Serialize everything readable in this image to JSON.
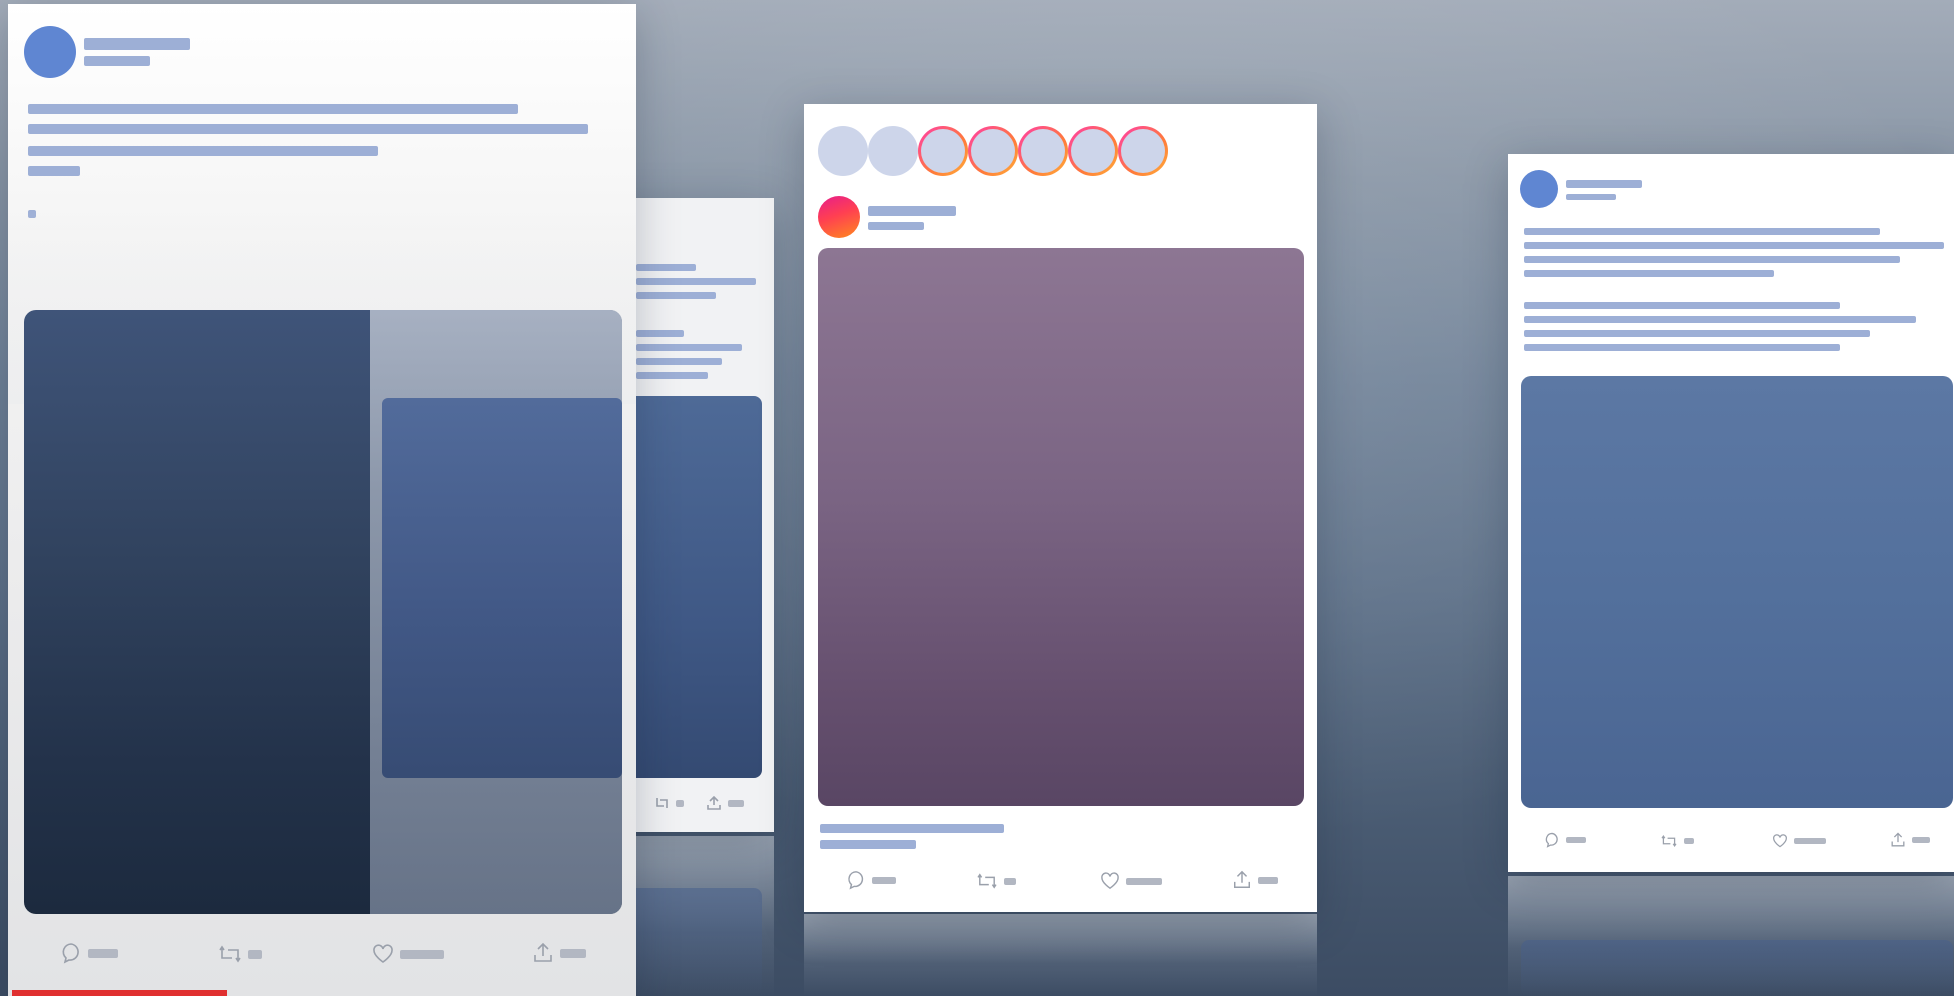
{
  "scene": {
    "description_label": "",
    "colors": {
      "background_top": "#a3acb9",
      "background_bottom": "#3c4c63",
      "placeholder_bar": "#9dafd6",
      "avatar_blue": "#5f86d2",
      "instagram_gradient": [
        "#e61e8c",
        "#ff3f52",
        "#ff8a1e"
      ],
      "instagram_media": "#7a6483",
      "tweet_media": "#31435f",
      "progress_red": "#e03030"
    }
  },
  "cards": {
    "front_tweet": {
      "type": "tweet",
      "actions": [
        {
          "icon": "comment-icon"
        },
        {
          "icon": "retweet-icon"
        },
        {
          "icon": "heart-icon"
        },
        {
          "icon": "share-icon"
        }
      ]
    },
    "back_tweet": {
      "type": "tweet",
      "actions": [
        {
          "icon": "comment-icon"
        },
        {
          "icon": "retweet-icon"
        },
        {
          "icon": "share-icon"
        }
      ]
    },
    "instagram_post": {
      "type": "instagram",
      "stories": [
        {
          "ring": false
        },
        {
          "ring": false
        },
        {
          "ring": true
        },
        {
          "ring": true
        },
        {
          "ring": true
        },
        {
          "ring": true
        },
        {
          "ring": true
        }
      ],
      "actions": [
        {
          "icon": "comment-icon"
        },
        {
          "icon": "retweet-icon"
        },
        {
          "icon": "heart-icon"
        },
        {
          "icon": "share-icon"
        }
      ]
    },
    "right_tweet": {
      "type": "tweet",
      "actions": [
        {
          "icon": "comment-icon"
        },
        {
          "icon": "retweet-icon"
        },
        {
          "icon": "heart-icon"
        },
        {
          "icon": "share-icon"
        }
      ]
    }
  },
  "video_progress": {
    "fraction": 0.11
  }
}
